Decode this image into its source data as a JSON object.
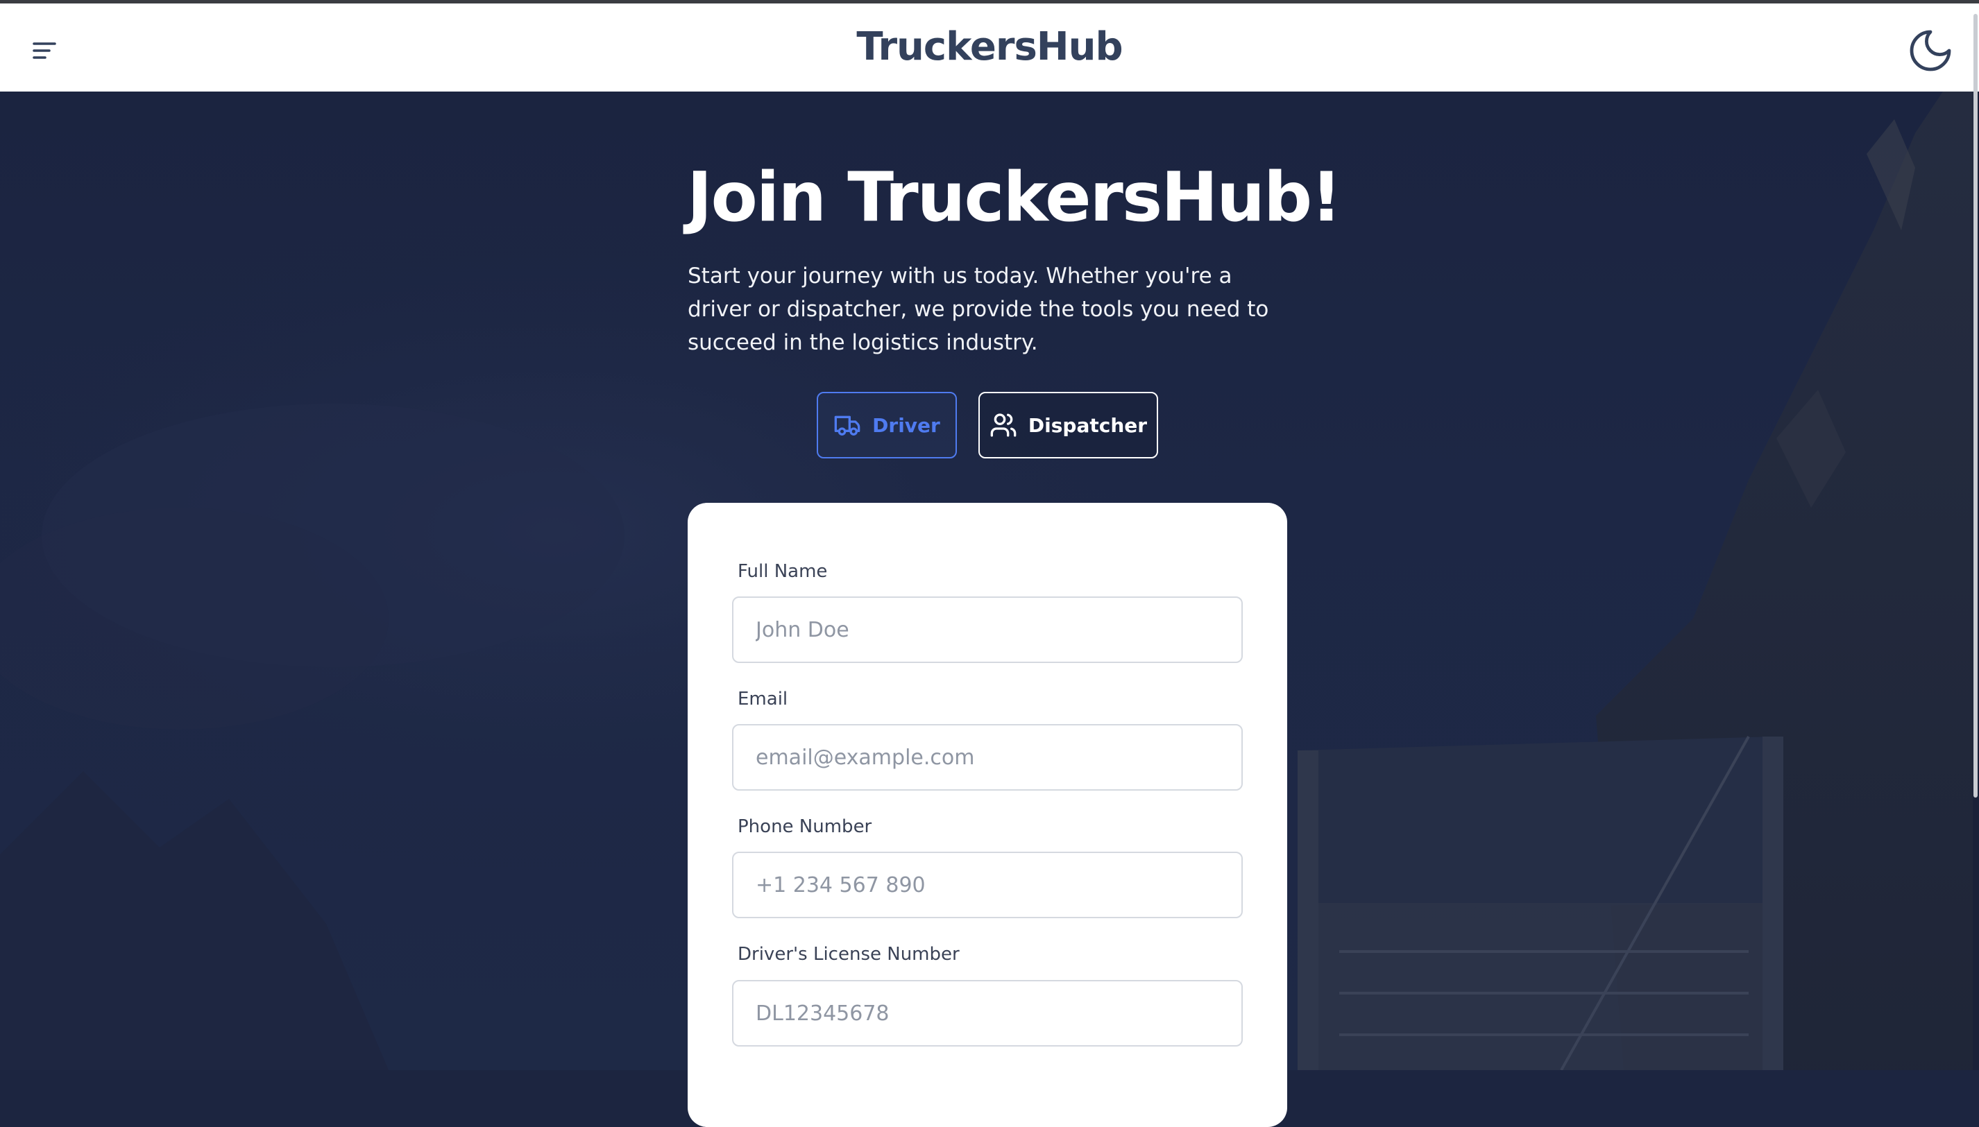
{
  "header": {
    "brand": "TruckersHub",
    "menu_icon": "menu-icon",
    "theme_icon": "moon-icon"
  },
  "hero": {
    "title": "Join TruckersHub!",
    "subtitle": "Start your journey with us today. Whether you're a driver or dispatcher, we provide the tools you need to succeed in the logistics industry."
  },
  "roles": [
    {
      "label": "Driver",
      "icon": "truck-icon",
      "selected": true
    },
    {
      "label": "Dispatcher",
      "icon": "users-icon",
      "selected": false
    }
  ],
  "form": {
    "fields": [
      {
        "label": "Full Name",
        "placeholder": "John Doe",
        "value": ""
      },
      {
        "label": "Email",
        "placeholder": "email@example.com",
        "value": ""
      },
      {
        "label": "Phone Number",
        "placeholder": "+1 234 567 890",
        "value": ""
      },
      {
        "label": "Driver's License Number",
        "placeholder": "DL12345678",
        "value": ""
      }
    ]
  },
  "colors": {
    "accent": "#4f7bf0",
    "brand_text": "#33415c",
    "hero_bg": "#1c2540",
    "card_bg": "#ffffff"
  }
}
